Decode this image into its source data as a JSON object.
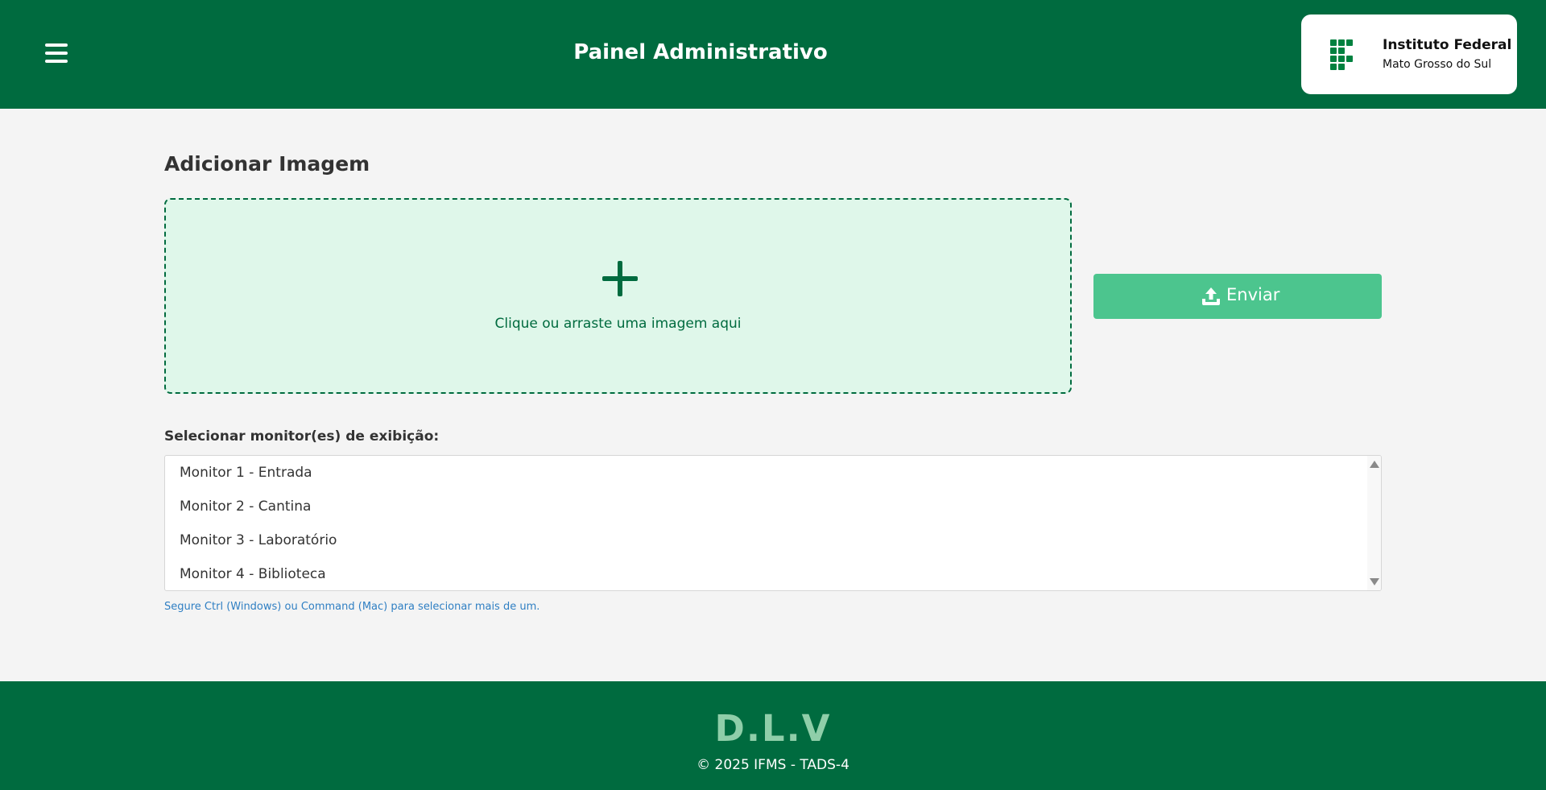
{
  "header": {
    "title": "Painel Administrativo",
    "menu_icon": "hamburger-menu-icon",
    "logo": {
      "line1": "Instituto Federal",
      "line2": "Mato Grosso do Sul",
      "icon": "ifms-logo-icon",
      "color": "#00813f"
    }
  },
  "main": {
    "section_title": "Adicionar Imagem",
    "dropzone": {
      "icon": "plus-icon",
      "text": "Clique ou arraste uma imagem aqui"
    },
    "send_button": {
      "label": "Enviar",
      "icon": "upload-icon"
    },
    "monitor_select": {
      "label": "Selecionar monitor(es) de exibição:",
      "options": [
        "Monitor 1 - Entrada",
        "Monitor 2 - Cantina",
        "Monitor 3 - Laboratório",
        "Monitor 4 - Biblioteca"
      ],
      "hint": "Segure Ctrl (Windows) ou Command (Mac) para selecionar mais de um."
    }
  },
  "footer": {
    "brand": "D.L.V",
    "copyright": "© 2025 IFMS - TADS-4"
  },
  "colors": {
    "primary": "#006b3f",
    "accent": "#4cc58e",
    "dropzone_bg": "#dff7ea",
    "page_bg": "#f4f4f4",
    "hint": "#2f7fc3",
    "footer_brand": "#8fcea9"
  }
}
